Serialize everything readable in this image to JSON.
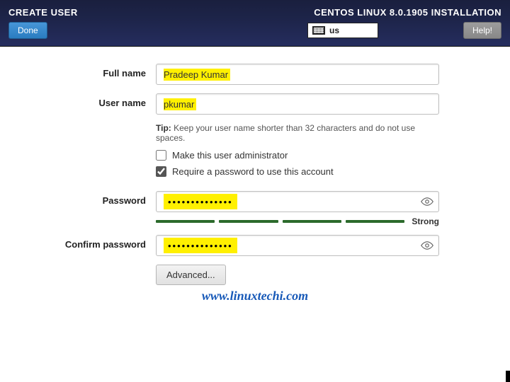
{
  "header": {
    "title": "CREATE USER",
    "installer": "CENTOS LINUX 8.0.1905 INSTALLATION",
    "done_label": "Done",
    "help_label": "Help!",
    "keyboard_layout": "us"
  },
  "form": {
    "full_name_label": "Full name",
    "full_name_value": "Pradeep Kumar",
    "user_name_label": "User name",
    "user_name_value": "pkumar",
    "tip_prefix": "Tip:",
    "tip_text": "Keep your user name shorter than 32 characters and do not use spaces.",
    "admin_checkbox_label": "Make this user administrator",
    "admin_checked": false,
    "require_pw_checkbox_label": "Require a password to use this account",
    "require_pw_checked": true,
    "password_label": "Password",
    "password_mask": "••••••••••••••",
    "strength_label": "Strong",
    "confirm_label": "Confirm password",
    "confirm_mask": "••••••••••••••",
    "advanced_label": "Advanced..."
  },
  "watermark": "www.linuxtechi.com"
}
